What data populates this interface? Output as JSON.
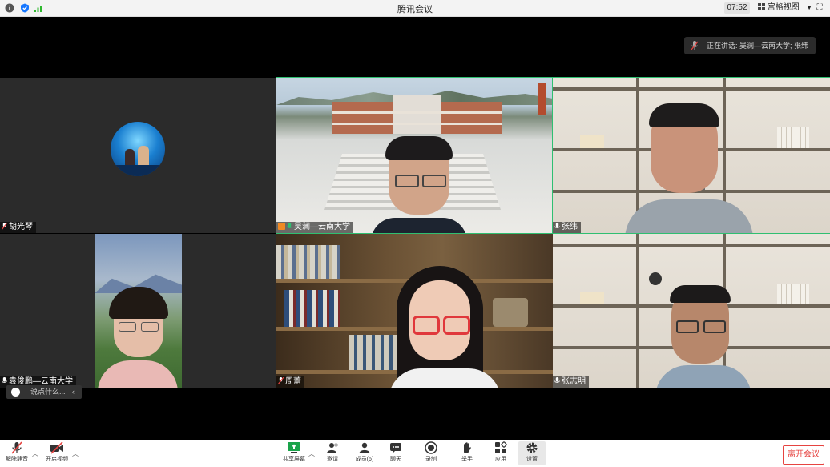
{
  "app": {
    "title": "腾讯会议"
  },
  "titlebar": {
    "time": "07:52",
    "view_label": "宫格视图"
  },
  "speaking": {
    "text": "正在讲话: 吴澜—云南大学; 张纬"
  },
  "participants": [
    {
      "name": "胡光琴"
    },
    {
      "name": "吴澜—云南大学"
    },
    {
      "name": "张纬"
    },
    {
      "name": "袁俊鹏—云南大学"
    },
    {
      "name": "周蕾"
    },
    {
      "name": "张志明"
    }
  ],
  "chat": {
    "placeholder": "说点什么..."
  },
  "toolbar": {
    "mute": "解除静音",
    "video": "开启视频",
    "share": "共享屏幕",
    "invite": "邀请",
    "members": "成员(6)",
    "chat": "聊天",
    "record": "录制",
    "raise_hand": "举手",
    "apps": "应用",
    "settings": "设置",
    "leave": "离开会议"
  }
}
